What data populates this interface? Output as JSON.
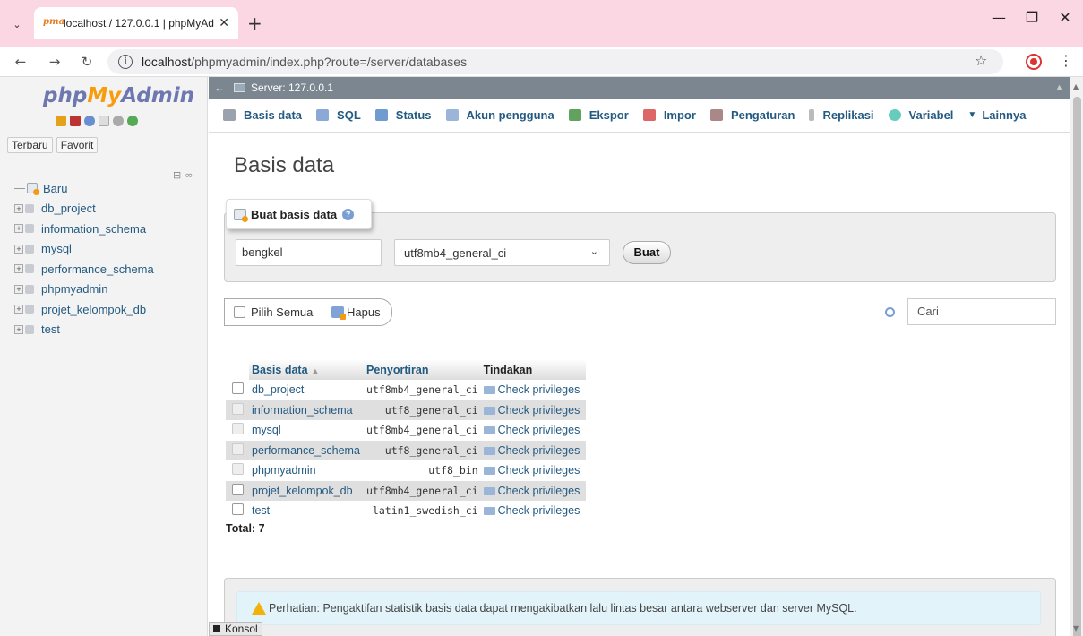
{
  "browser": {
    "tab_title": "localhost / 127.0.0.1 | phpMyAd",
    "url_host": "localhost",
    "url_path": "/phpmyadmin/index.php?route=/server/databases"
  },
  "nav": {
    "logo": {
      "php": "php",
      "my": "My",
      "admin": "Admin"
    },
    "tabs": [
      "Terbaru",
      "Favorit"
    ],
    "new_label": "Baru",
    "databases": [
      "db_project",
      "information_schema",
      "mysql",
      "performance_schema",
      "phpmyadmin",
      "projet_kelompok_db",
      "test"
    ]
  },
  "serverbar": {
    "label": "Server: 127.0.0.1"
  },
  "menu": [
    {
      "label": "Basis data",
      "icon_color": "#9aa3ad"
    },
    {
      "label": "SQL",
      "icon_color": "#8aa9d6"
    },
    {
      "label": "Status",
      "icon_color": "#6f9bd1"
    },
    {
      "label": "Akun pengguna",
      "icon_color": "#9bb5d9"
    },
    {
      "label": "Ekspor",
      "icon_color": "#5fa35f"
    },
    {
      "label": "Impor",
      "icon_color": "#d66"
    },
    {
      "label": "Pengaturan",
      "icon_color": "#a88"
    },
    {
      "label": "Replikasi",
      "icon_color": "#aaa"
    },
    {
      "label": "Variabel",
      "icon_color": "#6cb"
    },
    {
      "label": "Lainnya",
      "icon_color": "#333"
    }
  ],
  "main": {
    "title": "Basis data",
    "create": {
      "legend": "Buat basis data",
      "name_value": "bengkel",
      "collation_value": "utf8mb4_general_ci",
      "button": "Buat"
    },
    "select_all": "Pilih Semua",
    "delete": "Hapus",
    "search_placeholder": "Cari",
    "table": {
      "headers": [
        "Basis data",
        "Penyortiran",
        "Tindakan"
      ],
      "rows": [
        {
          "name": "db_project",
          "collation": "utf8mb4_general_ci",
          "action": "Check privileges"
        },
        {
          "name": "information_schema",
          "collation": "utf8_general_ci",
          "action": "Check privileges"
        },
        {
          "name": "mysql",
          "collation": "utf8mb4_general_ci",
          "action": "Check privileges"
        },
        {
          "name": "performance_schema",
          "collation": "utf8_general_ci",
          "action": "Check privileges"
        },
        {
          "name": "phpmyadmin",
          "collation": "utf8_bin",
          "action": "Check privileges"
        },
        {
          "name": "projet_kelompok_db",
          "collation": "utf8mb4_general_ci",
          "action": "Check privileges"
        },
        {
          "name": "test",
          "collation": "latin1_swedish_ci",
          "action": "Check privileges"
        }
      ]
    },
    "total": "Total: 7",
    "notice": "Perhatian: Pengaktifan statistik basis data dapat mengakibatkan lalu lintas besar antara webserver dan server MySQL."
  },
  "console": {
    "label": "Konsol"
  }
}
